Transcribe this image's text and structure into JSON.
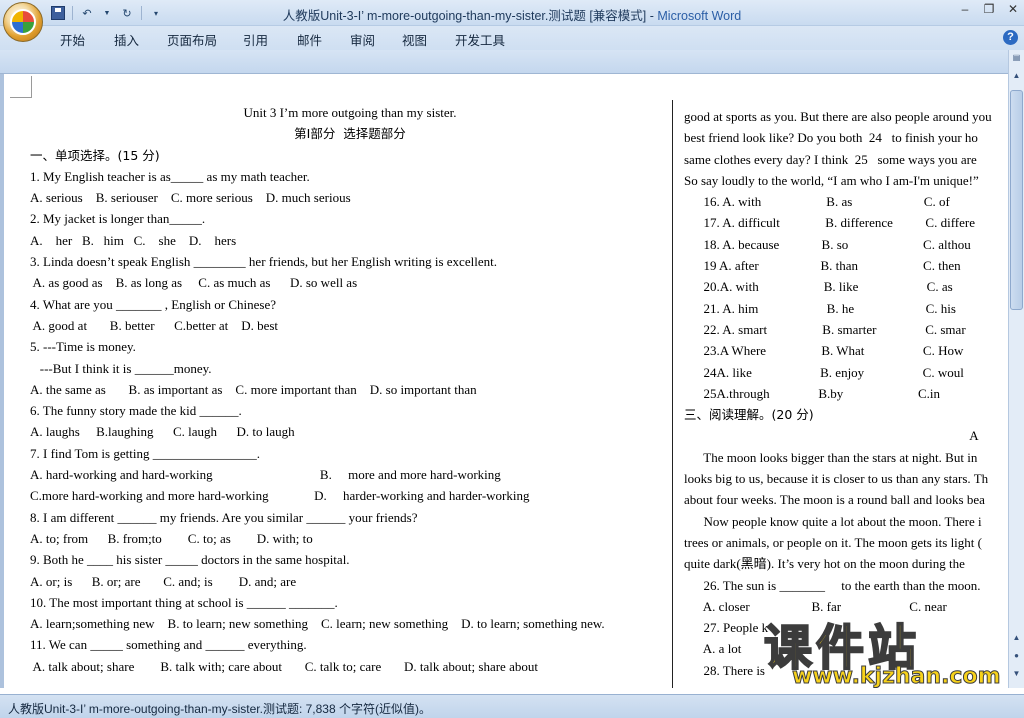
{
  "window": {
    "title_doc": "人教版Unit-3-I’   m-more-outgoing-than-my-sister.测试题 [兼容模式] - ",
    "title_app": "Microsoft Word"
  },
  "ribbon": {
    "tabs": [
      "开始",
      "插入",
      "页面布局",
      "引用",
      "邮件",
      "审阅",
      "视图",
      "开发工具"
    ]
  },
  "colors": {
    "titlebar": "#c9dbf0",
    "accent": "#2b5ea6",
    "watermark": "#f7d21b"
  },
  "left_column": [
    "Unit 3 I’m more outgoing than my sister.",
    "第Ⅰ部分  选择题部分",
    "一、单项选择。(15 分)",
    "1. My English teacher is as_____ as my math teacher.",
    "A. serious    B. seriouser    C. more serious    D. much serious",
    "2. My jacket is longer than_____.",
    "A.    her   B.   him   C.    she    D.    hers",
    "3. Linda doesn’t speak English ________ her friends, but her English writing is excellent.",
    " A. as good as    B. as long as     C. as much as      D. so well as",
    "4. What are you _______ , English or Chinese?",
    " A. good at       B. better      C.better at    D. best",
    "5. ---Time is money.",
    "   ---But I think it is ______money.",
    "A. the same as       B. as important as    C. more important than    D. so important than",
    "6. The funny story made the kid ______.",
    "A. laughs     B.laughing      C. laugh      D. to laugh",
    "7. I find Tom is getting ________________.",
    "A. hard-working and hard-working                                 B.     more and more hard-working",
    "C.more hard-working and more hard-working              D.     harder-working and harder-working",
    "8. I am different ______ my friends. Are you similar ______ your friends?",
    "A. to; from      B. from;to        C. to; as        D. with; to",
    "9. Both he ____ his sister _____ doctors in the same hospital.",
    "A. or; is      B. or; are       C. and; is        D. and; are",
    "10. The most important thing at school is ______ _______.",
    "A. learn;something new    B. to learn; new something    C. learn; new something    D. to learn; something new.",
    "11. We can _____ something and ______ everything.",
    " A. talk about; share        B. talk with; care about       C. talk to; care       D. talk about; share about"
  ],
  "right_column": [
    "good at sports as you. But there are also people around you",
    "best friend look like? Do you both  24   to finish your ho",
    "same clothes every day? I think  25   some ways you are",
    "So say loudly to the world, “I am who I am-I'm unique!”",
    "      16. A. with                    B. as                      C. of",
    "      17. A. difficult              B. difference          C. differe",
    "      18. A. because             B. so                       C. althou",
    "      19 A. after                   B. than                    C. then",
    "      20.A. with                    B. like                     C. as",
    "      21. A. him                     B. he                      C. his",
    "      22. A. smart                 B. smarter               C. smar",
    "      23.A Where                 B. What                  C. How",
    "      24A. like                     B. enjoy                  C. woul",
    "      25A.through               B.by                       C.in",
    "三、阅读理解。(20 分)",
    "                                                                                        A",
    "      The moon looks bigger than the stars at night. But in",
    "looks big to us, because it is closer to us than any stars. Th",
    "about four weeks. The moon is a round ball and looks bea",
    "      Now people know quite a lot about the moon. There i",
    "trees or animals, or people on it. The moon gets its light (",
    "quite dark(黑暗). It’s very hot on the moon during the",
    "      26. The sun is _______     to the earth than the moon.",
    "      A. closer                   B. far                     C. near",
    "      27. People k",
    "      A. a lot",
    "      28. There is"
  ],
  "status": {
    "text": "人教版Unit-3-I’   m-more-outgoing-than-my-sister.测试题: 7,838 个字符(近似值)。"
  },
  "watermark": {
    "cn": "课件站",
    "url": "www.kjzhan.com"
  }
}
